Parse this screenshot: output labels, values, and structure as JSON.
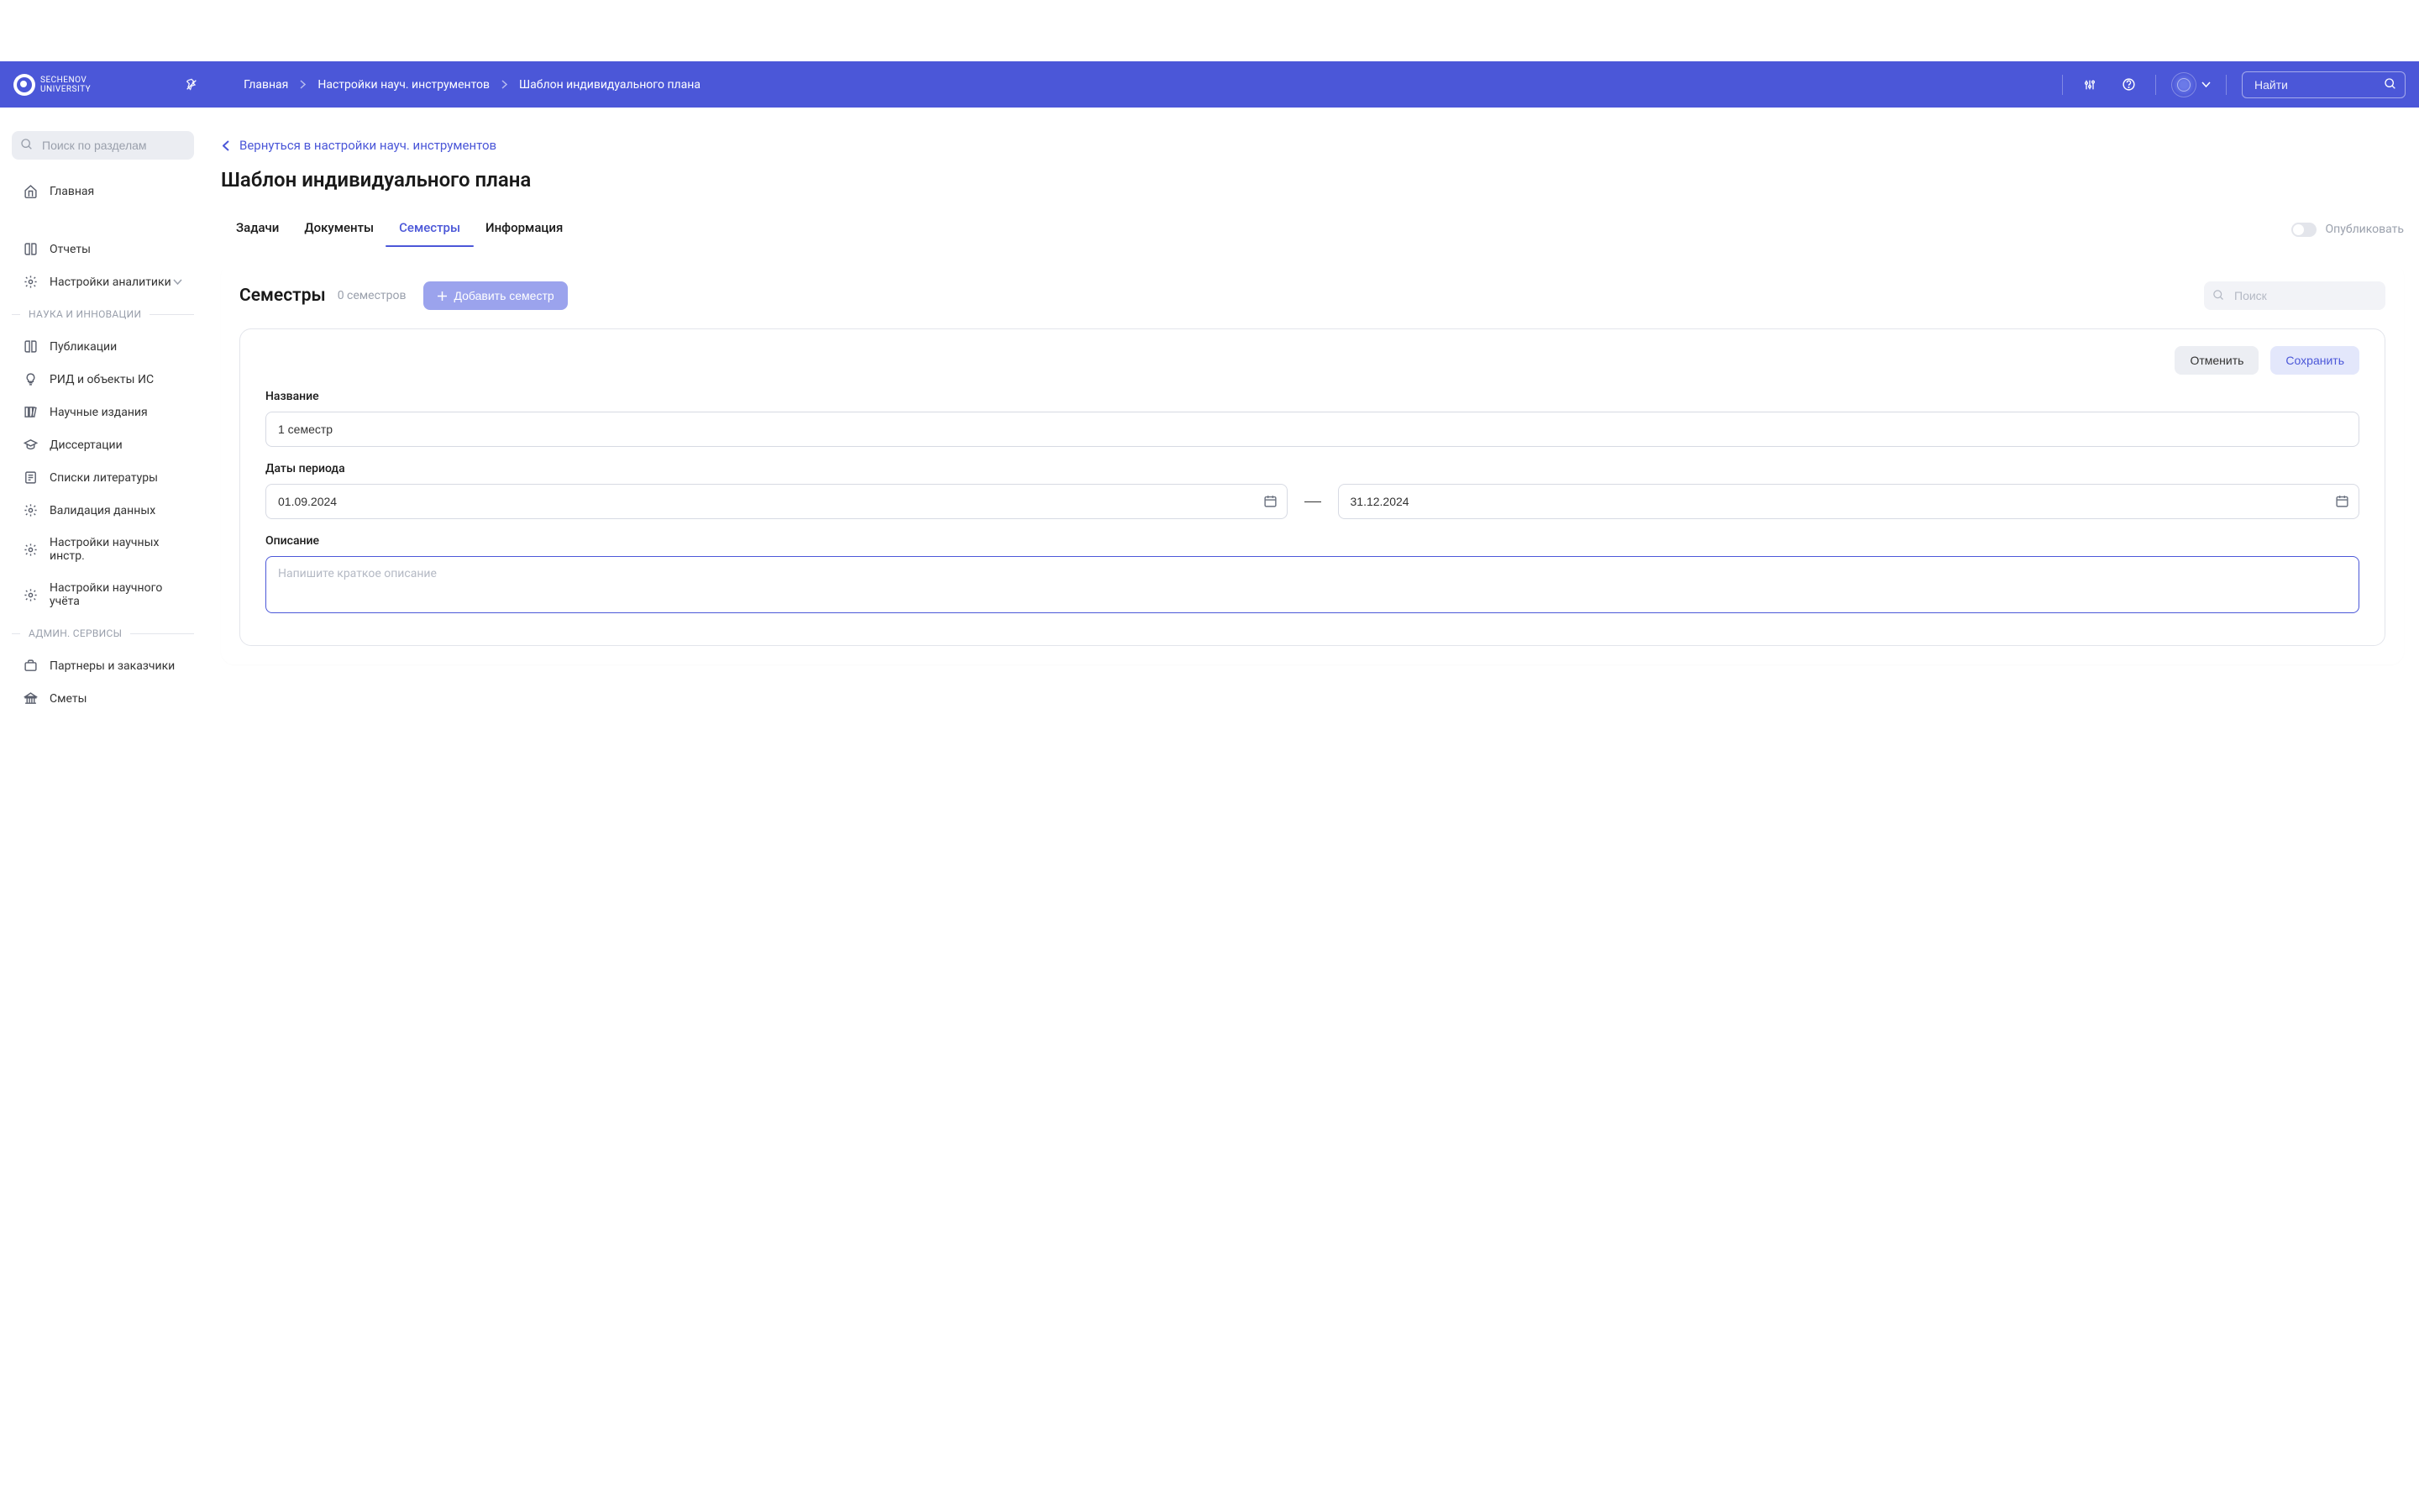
{
  "logo": {
    "line1": "SECHENOV",
    "line2": "UNIVERSITY"
  },
  "breadcrumb": [
    "Главная",
    "Настройки науч. инструментов",
    "Шаблон индивидуального плана"
  ],
  "topSearchPlaceholder": "Найти",
  "sidebar": {
    "searchPlaceholder": "Поиск по разделам",
    "home": "Главная",
    "reports": "Отчеты",
    "analytics": "Настройки аналитики",
    "section1": "НАУКА И ИННОВАЦИИ",
    "items1": [
      "Публикации",
      "РИД и объекты ИС",
      "Научные издания",
      "Диссертации",
      "Списки литературы",
      "Валидация данных",
      "Настройки научных инстр.",
      "Настройки научного учёта"
    ],
    "section2": "АДМИН. СЕРВИСЫ",
    "items2": [
      "Партнеры и заказчики",
      "Сметы"
    ]
  },
  "backlink": "Вернуться в настройки науч. инструментов",
  "pageTitle": "Шаблон индивидуального плана",
  "tabs": [
    "Задачи",
    "Документы",
    "Семестры",
    "Информация"
  ],
  "publishLabel": "Опубликовать",
  "card": {
    "title": "Семестры",
    "count": "0 семестров",
    "addLabel": "Добавить семестр",
    "searchPlaceholder": "Поиск"
  },
  "form": {
    "cancel": "Отменить",
    "save": "Сохранить",
    "nameLabel": "Название",
    "nameValue": "1 семестр",
    "datesLabel": "Даты периода",
    "dateStart": "01.09.2024",
    "dateEnd": "31.12.2024",
    "descLabel": "Описание",
    "descPlaceholder": "Напишите краткое описание"
  }
}
